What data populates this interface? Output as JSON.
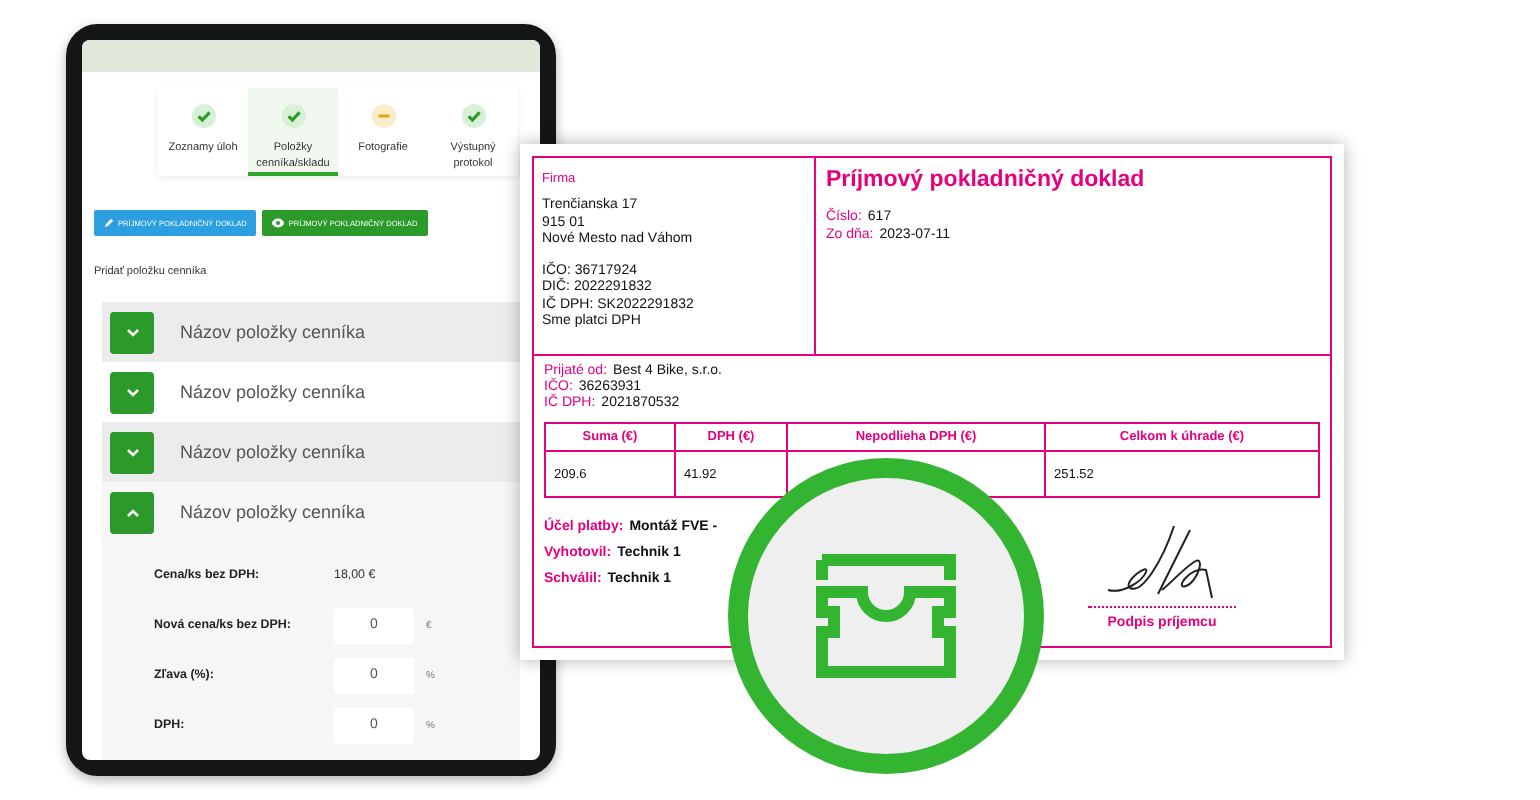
{
  "tablet": {
    "steps": [
      {
        "label": "Zoznamy úloh",
        "completed": true,
        "selected": false
      },
      {
        "label": "Položky cenníka/skladu",
        "completed": true,
        "selected": true
      },
      {
        "label": "Fotografie",
        "completed": false,
        "selected": false
      },
      {
        "label": "Výstupný protokol",
        "completed": true,
        "selected": false
      }
    ],
    "buttons": [
      {
        "label": "PRÍJMOVÝ POKLADNIČNÝ DOKLAD",
        "kind": "edit"
      },
      {
        "label": "PRÍJMOVÝ POKLADNIČNÝ DOKLAD",
        "kind": "view"
      }
    ],
    "add_link": "Pridať položku cenníka",
    "items": [
      {
        "name": "Názov položky cenníka",
        "expanded": false
      },
      {
        "name": "Názov položky cenníka",
        "expanded": false
      },
      {
        "name": "Názov položky cenníka",
        "expanded": false
      },
      {
        "name": "Názov položky cenníka",
        "expanded": true
      }
    ],
    "details": [
      {
        "label": "Cena/ks bez DPH:",
        "kind": "text",
        "value": "18,00 €"
      },
      {
        "label": "Nová cena/ks bez DPH:",
        "kind": "input",
        "value": "0",
        "unit": "€"
      },
      {
        "label": "Zľava (%):",
        "kind": "input",
        "value": "0",
        "unit": "%"
      },
      {
        "label": "DPH:",
        "kind": "input",
        "value": "0",
        "unit": "%"
      }
    ]
  },
  "receipt": {
    "company": {
      "heading": "Firma",
      "address": [
        "Trenčianska 17",
        "915 01",
        "Nové Mesto nad Váhom"
      ],
      "ids": [
        "IČO: 36717924",
        "DIČ: 2022291832",
        "IČ DPH: SK2022291832",
        "Sme platci DPH"
      ]
    },
    "title": "Príjmový pokladničný doklad",
    "meta": [
      {
        "label": "Číslo:",
        "value": "617"
      },
      {
        "label": "Zo dňa:",
        "value": "2023-07-11"
      }
    ],
    "payer": [
      {
        "label": "Prijaté od:",
        "value": "Best 4 Bike, s.r.o."
      },
      {
        "label": "IČO:",
        "value": "36263931"
      },
      {
        "label": "IČ DPH:",
        "value": "2021870532"
      }
    ],
    "table": {
      "columns": [
        "Suma (€)",
        "DPH (€)",
        "Nepodlieha DPH (€)",
        "Celkom k úhrade (€)"
      ],
      "rows": [
        {
          "cells": [
            "209.6",
            "41.92",
            null,
            "251.52"
          ]
        }
      ]
    },
    "notes": [
      {
        "label": "Účel platby:",
        "value": "Montáž FVE -"
      },
      {
        "label": "Vyhotovil:",
        "value": "Technik 1"
      },
      {
        "label": "Schválil:",
        "value": "Technik 1"
      }
    ],
    "signature": {
      "caption": "Podpis príjemcu"
    }
  }
}
